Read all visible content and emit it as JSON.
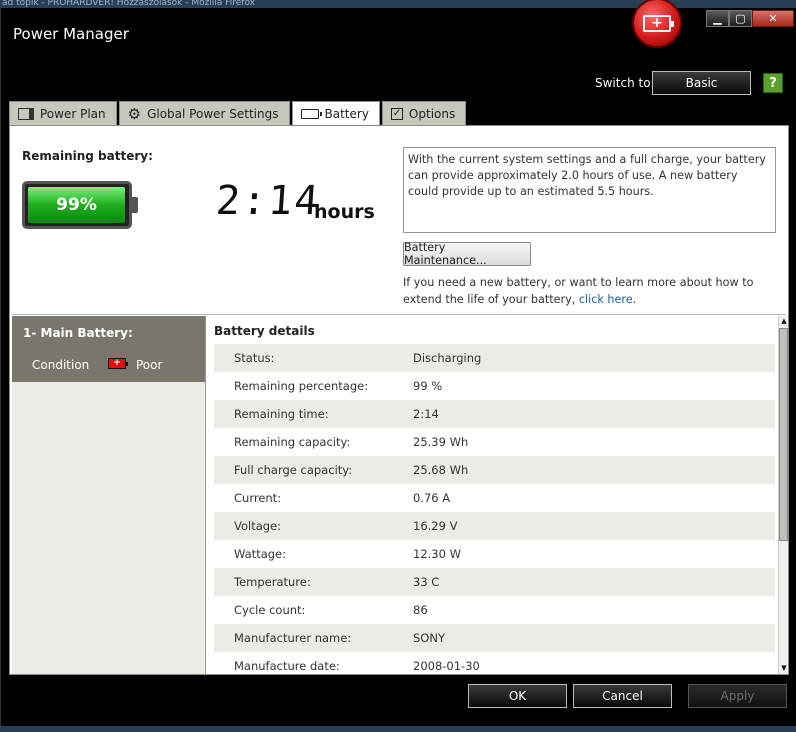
{
  "browser_strip": {
    "text": "ad topik - PROHARDVER! Hozzászólások - Mozilla Firefox"
  },
  "window": {
    "title": "Power Manager",
    "controls": {
      "minimize": "▁",
      "maximize": "▢",
      "close": "✕"
    }
  },
  "switch": {
    "label": "Switch to:",
    "button": "Basic"
  },
  "help": {
    "glyph": "?"
  },
  "tabs": [
    {
      "label": "Power Plan",
      "icon": "power-plan-icon"
    },
    {
      "label": "Global Power Settings",
      "icon": "gear-icon"
    },
    {
      "label": "Battery",
      "icon": "battery-icon",
      "active": true
    },
    {
      "label": "Options",
      "icon": "checkbox-icon"
    }
  ],
  "battery": {
    "remaining_label": "Remaining battery:",
    "percent_text": "99%",
    "level_percent": 99,
    "time": "2:14",
    "time_unit": "hours",
    "info": "With the current system settings and a full charge, your battery can provide approximately 2.0 hours of use. A new battery could provide up to an estimated 5.5 hours.",
    "maintenance_button": "Battery Maintenance...",
    "learn_text": "If you need a new battery, or want to learn more about how to extend the life of your battery,",
    "learn_link": "click here",
    "learn_end": "."
  },
  "side": {
    "title": "1- Main Battery:",
    "condition_label": "Condition",
    "mini_glyph": "+",
    "condition_value": "Poor"
  },
  "details": {
    "title": "Battery details",
    "rows": [
      {
        "k": "Status:",
        "v": "Discharging"
      },
      {
        "k": "Remaining percentage:",
        "v": "99 %"
      },
      {
        "k": "Remaining time:",
        "v": "2:14"
      },
      {
        "k": "Remaining capacity:",
        "v": "25.39 Wh"
      },
      {
        "k": "Full charge capacity:",
        "v": "25.68 Wh"
      },
      {
        "k": "Current:",
        "v": "0.76 A"
      },
      {
        "k": "Voltage:",
        "v": "16.29 V"
      },
      {
        "k": "Wattage:",
        "v": "12.30 W"
      },
      {
        "k": "Temperature:",
        "v": "33 C"
      },
      {
        "k": "Cycle count:",
        "v": "86"
      },
      {
        "k": "Manufacturer name:",
        "v": "SONY"
      },
      {
        "k": "Manufacture date:",
        "v": "2008-01-30"
      }
    ]
  },
  "scroll": {
    "up": "▲",
    "down": "▼"
  },
  "buttons": {
    "ok": "OK",
    "cancel": "Cancel",
    "apply": "Apply"
  },
  "colors": {
    "accent": "#1fae1f",
    "badge": "#d11a1a",
    "link": "#1c5fa8"
  }
}
